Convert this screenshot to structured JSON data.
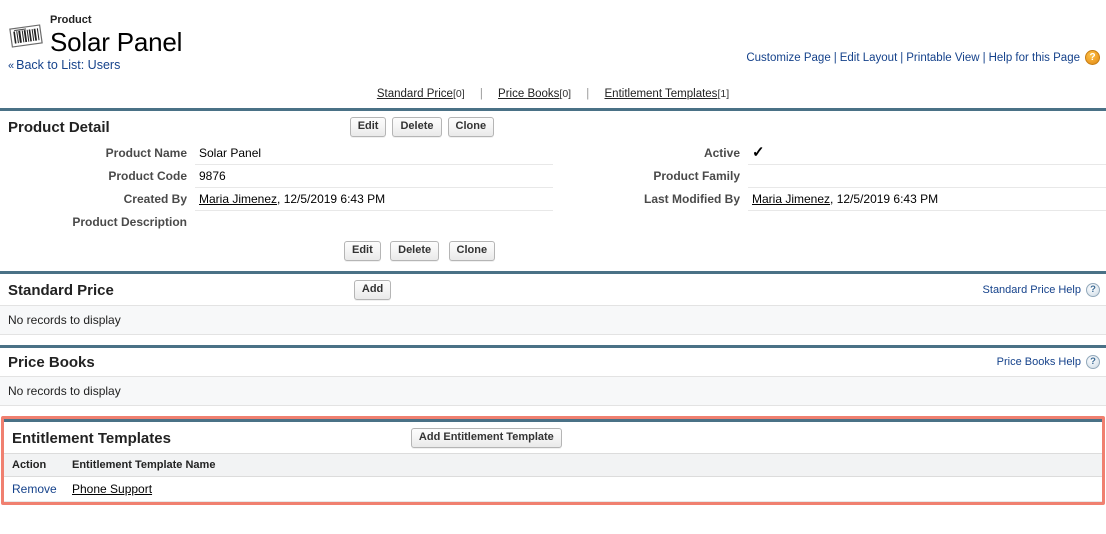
{
  "header": {
    "kicker": "Product",
    "title": "Solar Panel",
    "icon": "barcode-product-icon",
    "top_links": [
      {
        "label": "Customize Page"
      },
      {
        "label": "Edit Layout"
      },
      {
        "label": "Printable View"
      },
      {
        "label": "Help for this Page"
      }
    ],
    "help_icon_glyph": "?",
    "back_link": "Back to List: Users",
    "back_chevron": "«"
  },
  "jump_links": [
    {
      "label": "Standard Price",
      "count": "[0]"
    },
    {
      "label": "Price Books",
      "count": "[0]"
    },
    {
      "label": "Entitlement Templates",
      "count": "[1]"
    }
  ],
  "jump_separator": "|",
  "product_detail": {
    "title": "Product Detail",
    "buttons": [
      {
        "label": "Edit",
        "name": "edit-button"
      },
      {
        "label": "Delete",
        "name": "delete-button"
      },
      {
        "label": "Clone",
        "name": "clone-button"
      }
    ],
    "fields": [
      {
        "left_label": "Product Name",
        "left_value": "Solar Panel",
        "right_label": "Active",
        "right_value": "✓",
        "right_is_check": true
      },
      {
        "left_label": "Product Code",
        "left_value": "9876",
        "right_label": "Product Family",
        "right_value": ""
      },
      {
        "left_label": "Created By",
        "left_link": "Maria Jimenez",
        "left_value": ", 12/5/2019 6:43 PM",
        "right_label": "Last Modified By",
        "right_link": "Maria Jimenez",
        "right_value": ", 12/5/2019 6:43 PM"
      },
      {
        "left_label": "Product Description",
        "left_value": "",
        "right_label": "",
        "right_value": ""
      }
    ]
  },
  "standard_price": {
    "title": "Standard Price",
    "add_button": "Add",
    "help_label": "Standard Price Help",
    "help_icon_glyph": "?",
    "empty_message": "No records to display"
  },
  "price_books": {
    "title": "Price Books",
    "help_label": "Price Books Help",
    "help_icon_glyph": "?",
    "empty_message": "No records to display"
  },
  "entitlement_templates": {
    "title": "Entitlement Templates",
    "add_button": "Add Entitlement Template",
    "columns": [
      "Action",
      "Entitlement Template Name"
    ],
    "rows": [
      {
        "action": "Remove",
        "name": "Phone Support"
      }
    ],
    "highlight_color": "#f08070"
  },
  "colors": {
    "section_rule": "#4a7186",
    "link_blue": "#15428b",
    "highlight_red": "#f08070"
  }
}
